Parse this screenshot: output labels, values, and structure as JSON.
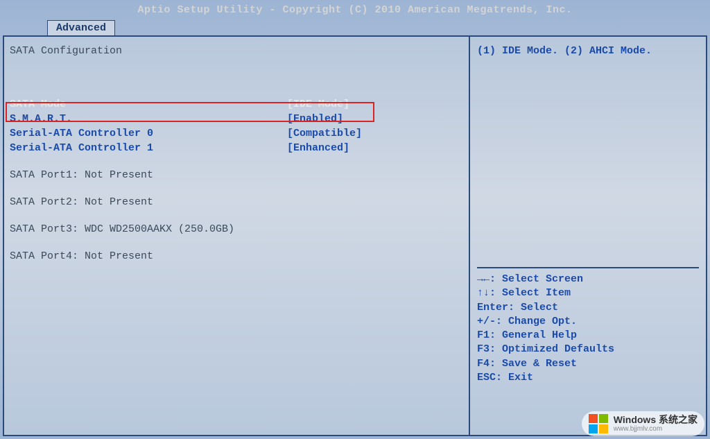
{
  "header": {
    "title": "Aptio Setup Utility - Copyright (C) 2010 American Megatrends, Inc."
  },
  "tab": {
    "label": "Advanced"
  },
  "section": {
    "title": "SATA Configuration"
  },
  "settings": [
    {
      "label": "SATA Mode",
      "value": "[IDE Mode]",
      "selected": true
    },
    {
      "label": "S.M.A.R.T.",
      "value": "[Enabled]",
      "selected": false
    },
    {
      "label": "Serial-ATA Controller 0",
      "value": "[Compatible]",
      "selected": false
    },
    {
      "label": "Serial-ATA Controller 1",
      "value": "[Enhanced]",
      "selected": false
    }
  ],
  "ports": [
    "SATA Port1: Not Present",
    "SATA Port2: Not Present",
    "SATA Port3: WDC WD2500AAKX (250.0GB)",
    "SATA Port4: Not Present"
  ],
  "help": {
    "description": "(1) IDE Mode. (2) AHCI Mode.",
    "keys": [
      "→←: Select Screen",
      "↑↓: Select Item",
      "Enter: Select",
      "+/-: Change Opt.",
      "F1: General Help",
      "F3: Optimized Defaults",
      "F4: Save & Reset",
      "ESC: Exit"
    ]
  },
  "watermark": {
    "line1": "Windows 系统之家",
    "line2": "www.bjjmlv.com"
  }
}
